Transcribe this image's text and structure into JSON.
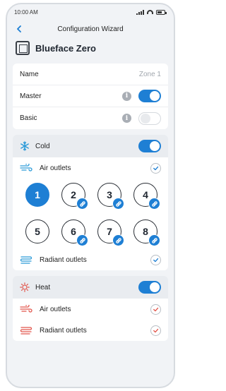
{
  "status": {
    "time": "10:00 AM"
  },
  "nav": {
    "title": "Configuration Wizard"
  },
  "device": {
    "name": "Blueface Zero"
  },
  "settings": {
    "name_label": "Name",
    "name_value": "Zone 1",
    "master_label": "Master",
    "master_on": true,
    "basic_label": "Basic",
    "basic_on": false
  },
  "cold": {
    "label": "Cold",
    "enabled": true,
    "air_outlets_label": "Air outlets",
    "zones": [
      "1",
      "2",
      "3",
      "4",
      "5",
      "6",
      "7",
      "8"
    ],
    "active_zone": "1",
    "radiant_outlets_label": "Radiant outlets"
  },
  "heat": {
    "label": "Heat",
    "enabled": true,
    "air_outlets_label": "Air outlets",
    "radiant_outlets_label": "Radiant outlets"
  },
  "colors": {
    "accent": "#1e7fd4",
    "cold_icon": "#2a9ad8",
    "heat_icon": "#e2554b"
  },
  "icons": [
    "back-chevron-icon",
    "device-icon",
    "info-icon",
    "snowflake-icon",
    "sun-icon",
    "air-outlet-icon",
    "radiant-outlet-icon",
    "check-icon",
    "link-icon"
  ]
}
